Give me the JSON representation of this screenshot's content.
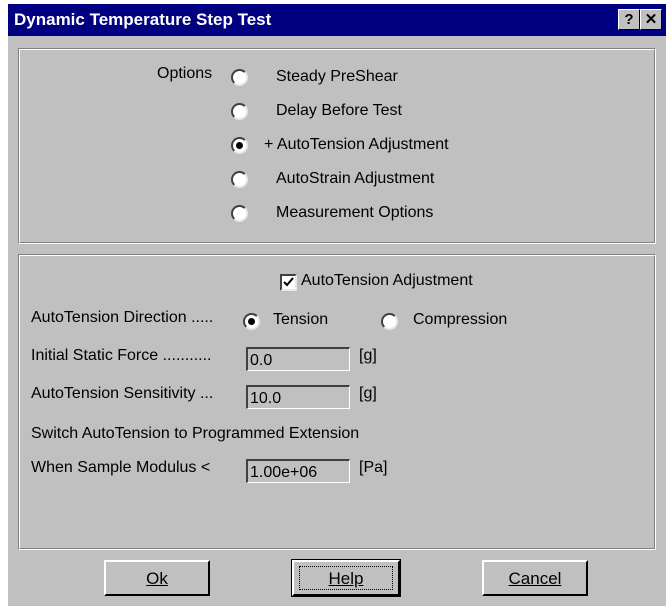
{
  "dialog": {
    "title": "Dynamic Temperature Step Test",
    "help_button": "?",
    "close_button": "✕"
  },
  "options": {
    "label": "Options",
    "items": [
      {
        "label": "Steady PreShear",
        "selected": false
      },
      {
        "label": "Delay Before Test",
        "selected": false
      },
      {
        "label": "+ AutoTension Adjustment",
        "selected": true
      },
      {
        "label": "AutoStrain Adjustment",
        "selected": false
      },
      {
        "label": "Measurement Options",
        "selected": false
      }
    ]
  },
  "autotension": {
    "checkbox_label": "AutoTension Adjustment",
    "checkbox_checked": true,
    "direction_label": "AutoTension Direction .....",
    "direction_tension": "Tension",
    "direction_compression": "Compression",
    "direction_selected": "Tension",
    "initial_force_label": "Initial Static Force ...........",
    "initial_force_value": "0.0",
    "initial_force_unit": "[g]",
    "sensitivity_label": "AutoTension Sensitivity ...",
    "sensitivity_value": "10.0",
    "sensitivity_unit": "[g]",
    "switch_label": "Switch AutoTension to Programmed Extension",
    "modulus_label": "When Sample Modulus <",
    "modulus_value": "1.00e+06",
    "modulus_unit": "[Pa]"
  },
  "buttons": {
    "ok": "Ok",
    "help": "Help",
    "cancel": "Cancel"
  }
}
